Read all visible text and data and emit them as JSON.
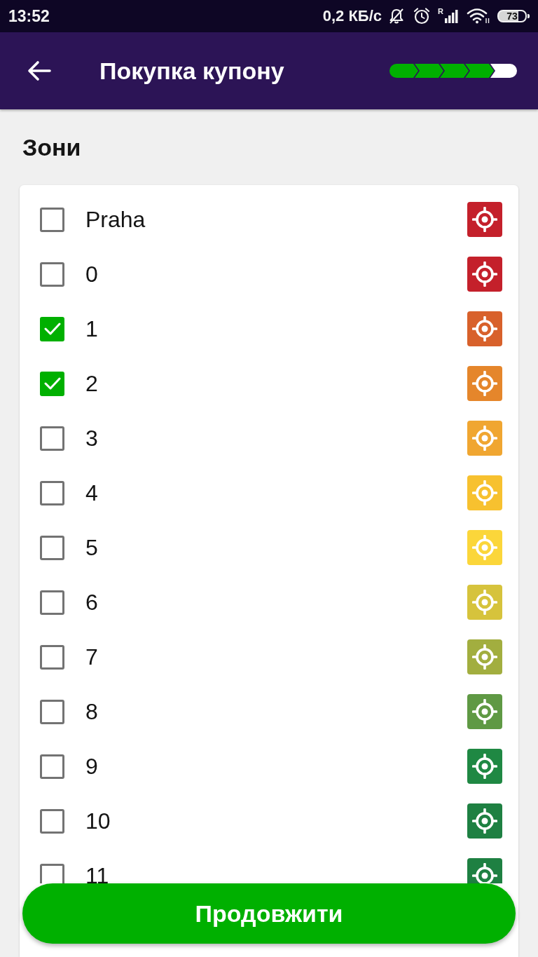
{
  "status_bar": {
    "time": "13:52",
    "network_speed": "0,2 КБ/с",
    "roaming": "R",
    "battery": "73"
  },
  "app_bar": {
    "title": "Покупка купону",
    "steps": [
      {
        "completed": true
      },
      {
        "completed": true
      },
      {
        "completed": true
      },
      {
        "completed": true
      },
      {
        "completed": false
      }
    ]
  },
  "section_title": "Зони",
  "zones": [
    {
      "label": "Praha",
      "checked": false,
      "color": "#c4202b"
    },
    {
      "label": "0",
      "checked": false,
      "color": "#c4202b"
    },
    {
      "label": "1",
      "checked": true,
      "color": "#d8612b"
    },
    {
      "label": "2",
      "checked": true,
      "color": "#e5862b"
    },
    {
      "label": "3",
      "checked": false,
      "color": "#f0a631"
    },
    {
      "label": "4",
      "checked": false,
      "color": "#f7c12f"
    },
    {
      "label": "5",
      "checked": false,
      "color": "#fbd63a"
    },
    {
      "label": "6",
      "checked": false,
      "color": "#d6c33c"
    },
    {
      "label": "7",
      "checked": false,
      "color": "#a2ae3f"
    },
    {
      "label": "8",
      "checked": false,
      "color": "#5f9944"
    },
    {
      "label": "9",
      "checked": false,
      "color": "#1f8843"
    },
    {
      "label": "10",
      "checked": false,
      "color": "#1e8042"
    },
    {
      "label": "11",
      "checked": false,
      "color": "#1e8042"
    }
  ],
  "button": {
    "label": "Продовжити"
  }
}
